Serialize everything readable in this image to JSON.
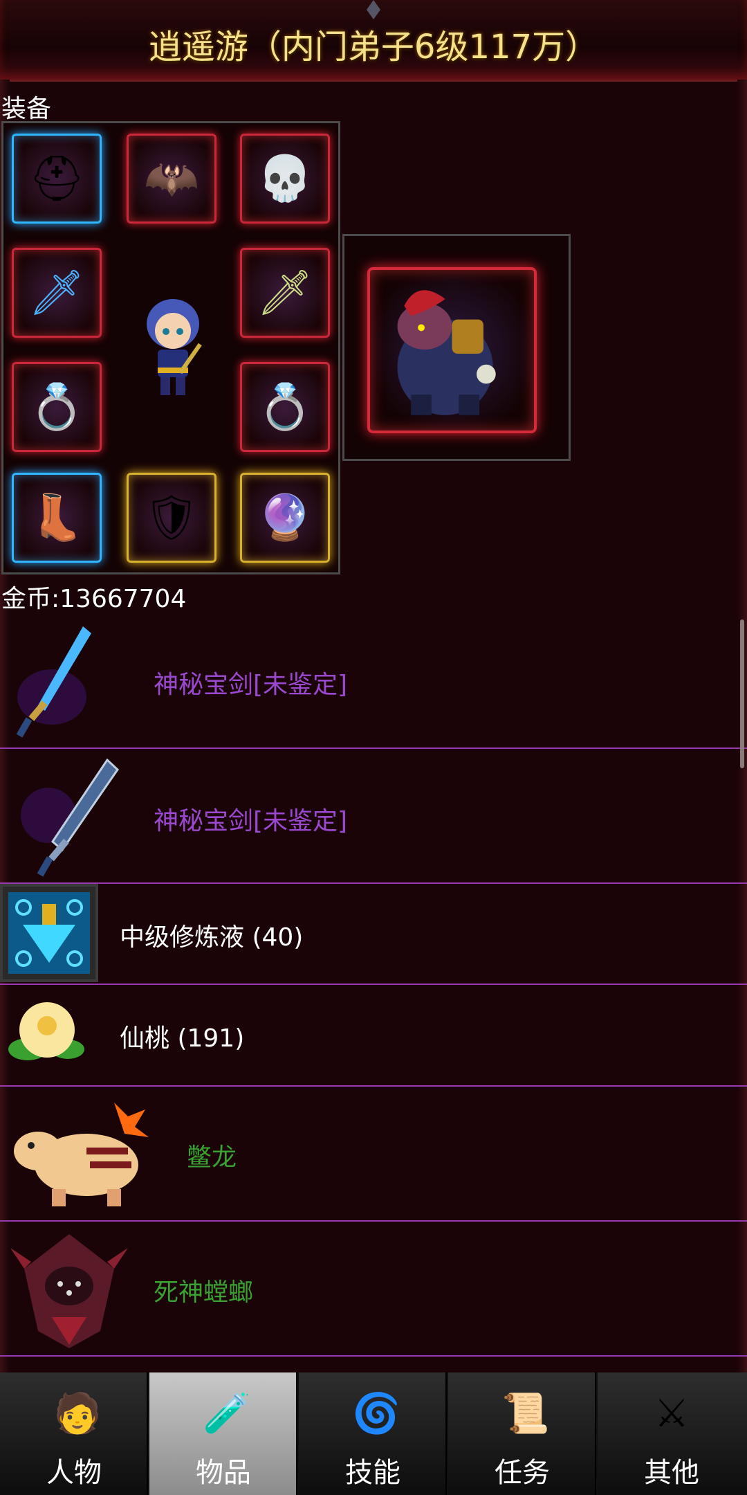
{
  "title": "逍遥游（内门弟子6级117万）",
  "equipment_label": "装备",
  "gold_label": "金币:13667704",
  "items": [
    {
      "name": "神秘宝剑[未鉴定]",
      "icon": "sword-icon"
    },
    {
      "name": "神秘宝剑[未鉴定]",
      "icon": "sword-icon"
    },
    {
      "name": "中级修炼液 (40)",
      "icon": "potion-icon"
    },
    {
      "name": "仙桃 (191)",
      "icon": "peach-icon"
    },
    {
      "name": "鳖龙",
      "icon": "dragon-icon"
    },
    {
      "name": "死神螳螂",
      "icon": "mantis-icon"
    }
  ],
  "tabs": [
    {
      "label": "人物",
      "icon": "character-icon"
    },
    {
      "label": "物品",
      "icon": "bag-icon",
      "active": true
    },
    {
      "label": "技能",
      "icon": "skill-icon"
    },
    {
      "label": "任务",
      "icon": "quest-icon"
    },
    {
      "label": "其他",
      "icon": "other-icon"
    }
  ],
  "colors": {
    "item_purple": "#9a48d0",
    "item_green": "#3aa030",
    "title": "#f4e28a",
    "divider": "#9a3ab0"
  }
}
